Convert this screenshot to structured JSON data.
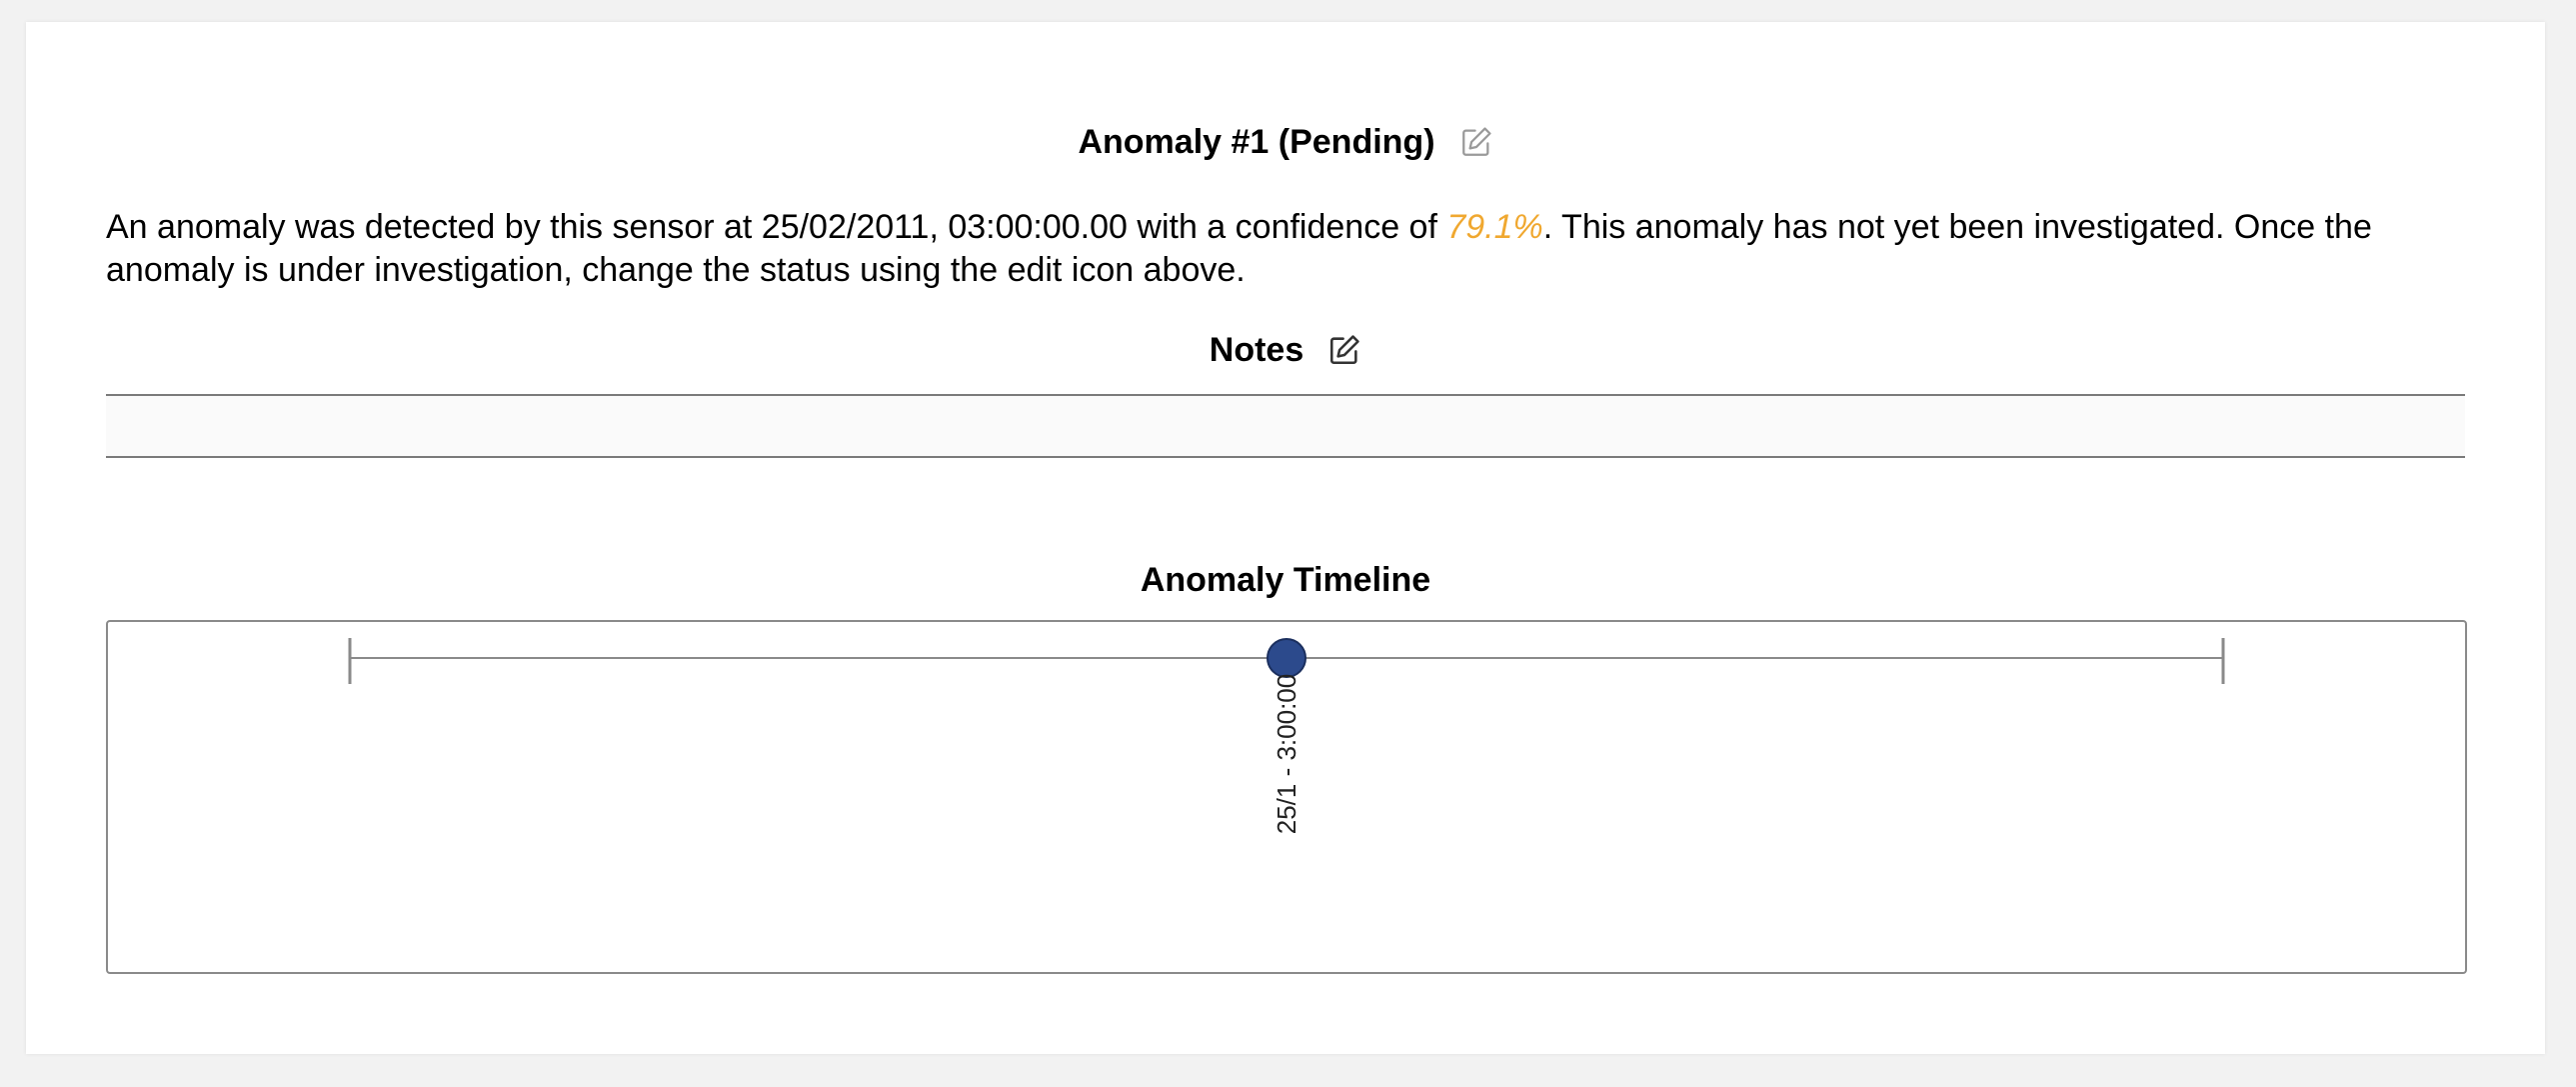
{
  "anomaly": {
    "title": "Anomaly #1 (Pending)",
    "description_prefix": "An anomaly was detected by this sensor at 25/02/2011, 03:00:00.00 with a confidence of ",
    "confidence": "79.1%",
    "description_suffix": ". This anomaly has not yet been investigated. Once the anomaly is under investigation, change the status using the edit icon above.",
    "edit_icon": "edit-icon"
  },
  "notes": {
    "title": "Notes",
    "content": "",
    "edit_icon": "edit-icon"
  },
  "timeline": {
    "title": "Anomaly Timeline",
    "event_label": "25/1 - 3:00:00",
    "event_position": 0.5,
    "colors": {
      "marker_fill": "#2c4a8c",
      "marker_stroke": "#1b2f5e",
      "axis": "#8a8a8a"
    }
  },
  "colors": {
    "confidence": "#f0a830"
  }
}
